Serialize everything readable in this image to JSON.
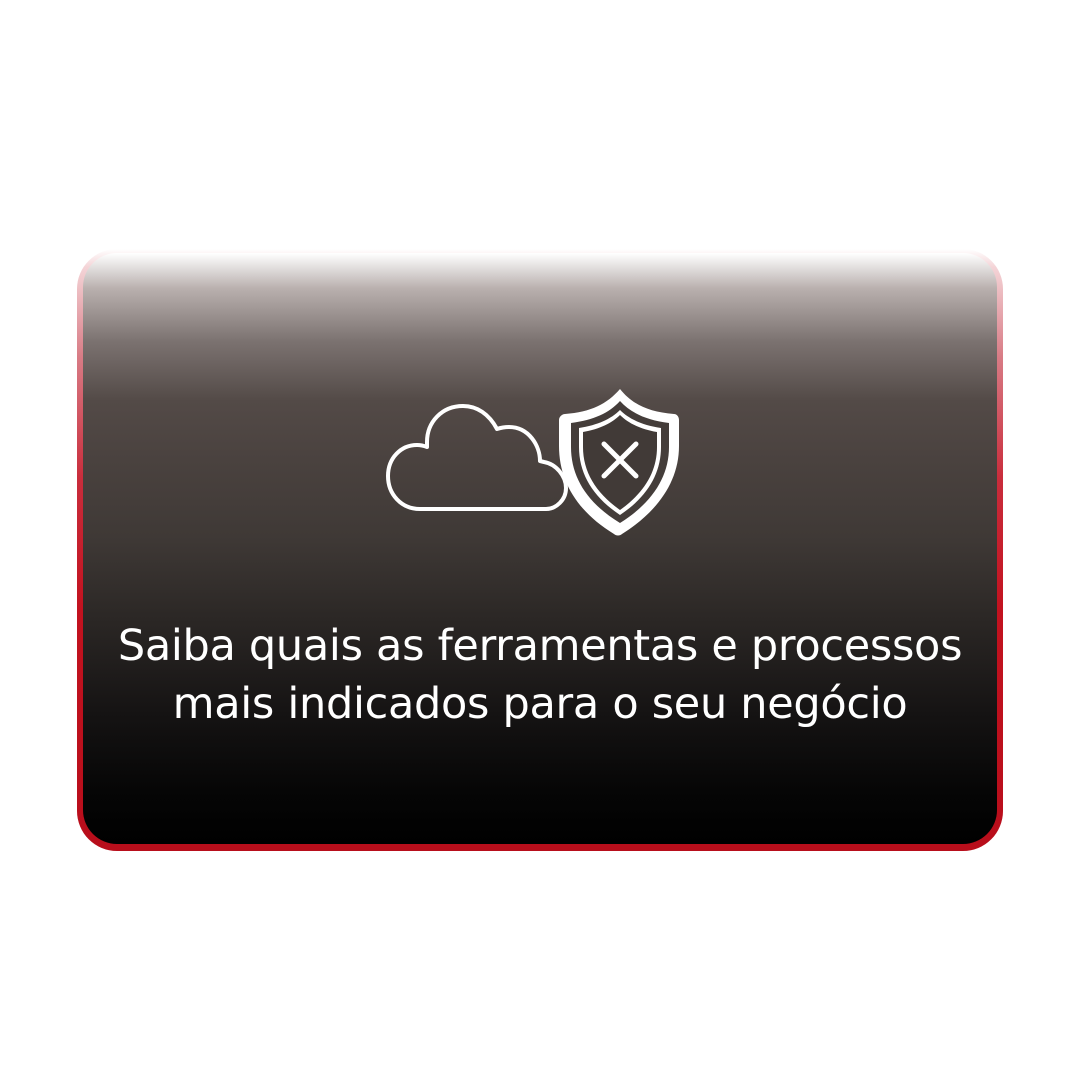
{
  "message": {
    "line1": "Saiba quais as ferramentas e processos",
    "line2": "mais indicados para o seu negócio"
  },
  "icons": {
    "cloud": "cloud-icon",
    "shield": "shield-x-icon"
  },
  "colors": {
    "accent_border": "#c2121f",
    "card_top": "#ffffff",
    "card_bottom": "#000000",
    "text": "#ffffff"
  }
}
